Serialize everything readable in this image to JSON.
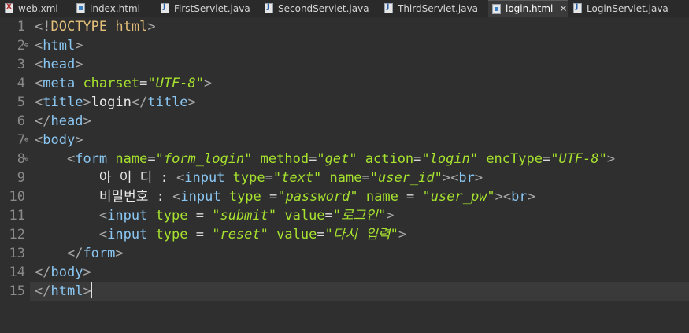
{
  "tabs": [
    {
      "label": "web.xml",
      "icon": "xml-file-icon"
    },
    {
      "label": "index.html",
      "icon": "html-file-icon"
    },
    {
      "label": "FirstServlet.java",
      "icon": "java-file-icon"
    },
    {
      "label": "SecondServlet.java",
      "icon": "java-file-icon"
    },
    {
      "label": "ThirdServlet.java",
      "icon": "java-file-icon"
    },
    {
      "label": "login.html",
      "icon": "html-file-icon",
      "active": true
    },
    {
      "label": "LoginServlet.java",
      "icon": "java-file-icon"
    }
  ],
  "close_symbol": "✕",
  "line_numbers": [
    "1",
    "2",
    "3",
    "4",
    "5",
    "6",
    "7",
    "8",
    "9",
    "10",
    "11",
    "12",
    "13",
    "14",
    "15"
  ],
  "code": {
    "l1": {
      "a": "<!",
      "b": "DOCTYPE",
      "c": " html",
      "d": ">"
    },
    "l2": {
      "a": "<",
      "b": "html",
      "c": ">"
    },
    "l3": {
      "a": "<",
      "b": "head",
      "c": ">"
    },
    "l4": {
      "a": "<",
      "b": "meta",
      "c": " charset",
      "d": "=",
      "e": "\"UTF-8\"",
      "f": ">"
    },
    "l5": {
      "a": "<",
      "b": "title",
      "c": ">",
      "d": "login",
      "e": "</",
      "f": "title",
      "g": ">"
    },
    "l6": {
      "a": "</",
      "b": "head",
      "c": ">"
    },
    "l7": {
      "a": "<",
      "b": "body",
      "c": ">"
    },
    "l8": {
      "indent": "    ",
      "a": "<",
      "b": "form",
      "c": " name",
      "d": "=",
      "e": "\"form_login\"",
      "f": " method",
      "g": "=",
      "h": "\"get\"",
      "i": " action",
      "j": "=",
      "k": "\"login\"",
      "l": " encType",
      "m": "=",
      "n": "\"UTF-8\"",
      "o": ">"
    },
    "l9": {
      "indent": "        ",
      "t": "아 이 디 : ",
      "a": "<",
      "b": "input",
      "c": " type",
      "d": "=",
      "e": "\"text\"",
      "f": " name",
      "g": "=",
      "h": "\"user_id\"",
      "i": ">",
      "j": "<",
      "k": "br",
      "l": ">"
    },
    "l10": {
      "indent": "        ",
      "t": "비밀번호 : ",
      "a": "<",
      "b": "input",
      "c": " type ",
      "d": "=",
      "e": "\"password\"",
      "f": " name ",
      "g": "= ",
      "h": "\"user_pw\"",
      "i": ">",
      "j": "<",
      "k": "br",
      "l": ">"
    },
    "l11": {
      "indent": "        ",
      "a": "<",
      "b": "input",
      "c": " type ",
      "d": "= ",
      "e": "\"submit\"",
      "f": " value",
      "g": "=",
      "h": "\"로그인\"",
      "i": ">"
    },
    "l12": {
      "indent": "        ",
      "a": "<",
      "b": "input",
      "c": " type ",
      "d": "= ",
      "e": "\"reset\"",
      "f": " value",
      "g": "=",
      "h": "\"다시 입력\"",
      "i": ">"
    },
    "l13": {
      "indent": "    ",
      "a": "</",
      "b": "form",
      "c": ">"
    },
    "l14": {
      "a": "</",
      "b": "body",
      "c": ">"
    },
    "l15": {
      "a": "</",
      "b": "html",
      "c": ">"
    }
  }
}
